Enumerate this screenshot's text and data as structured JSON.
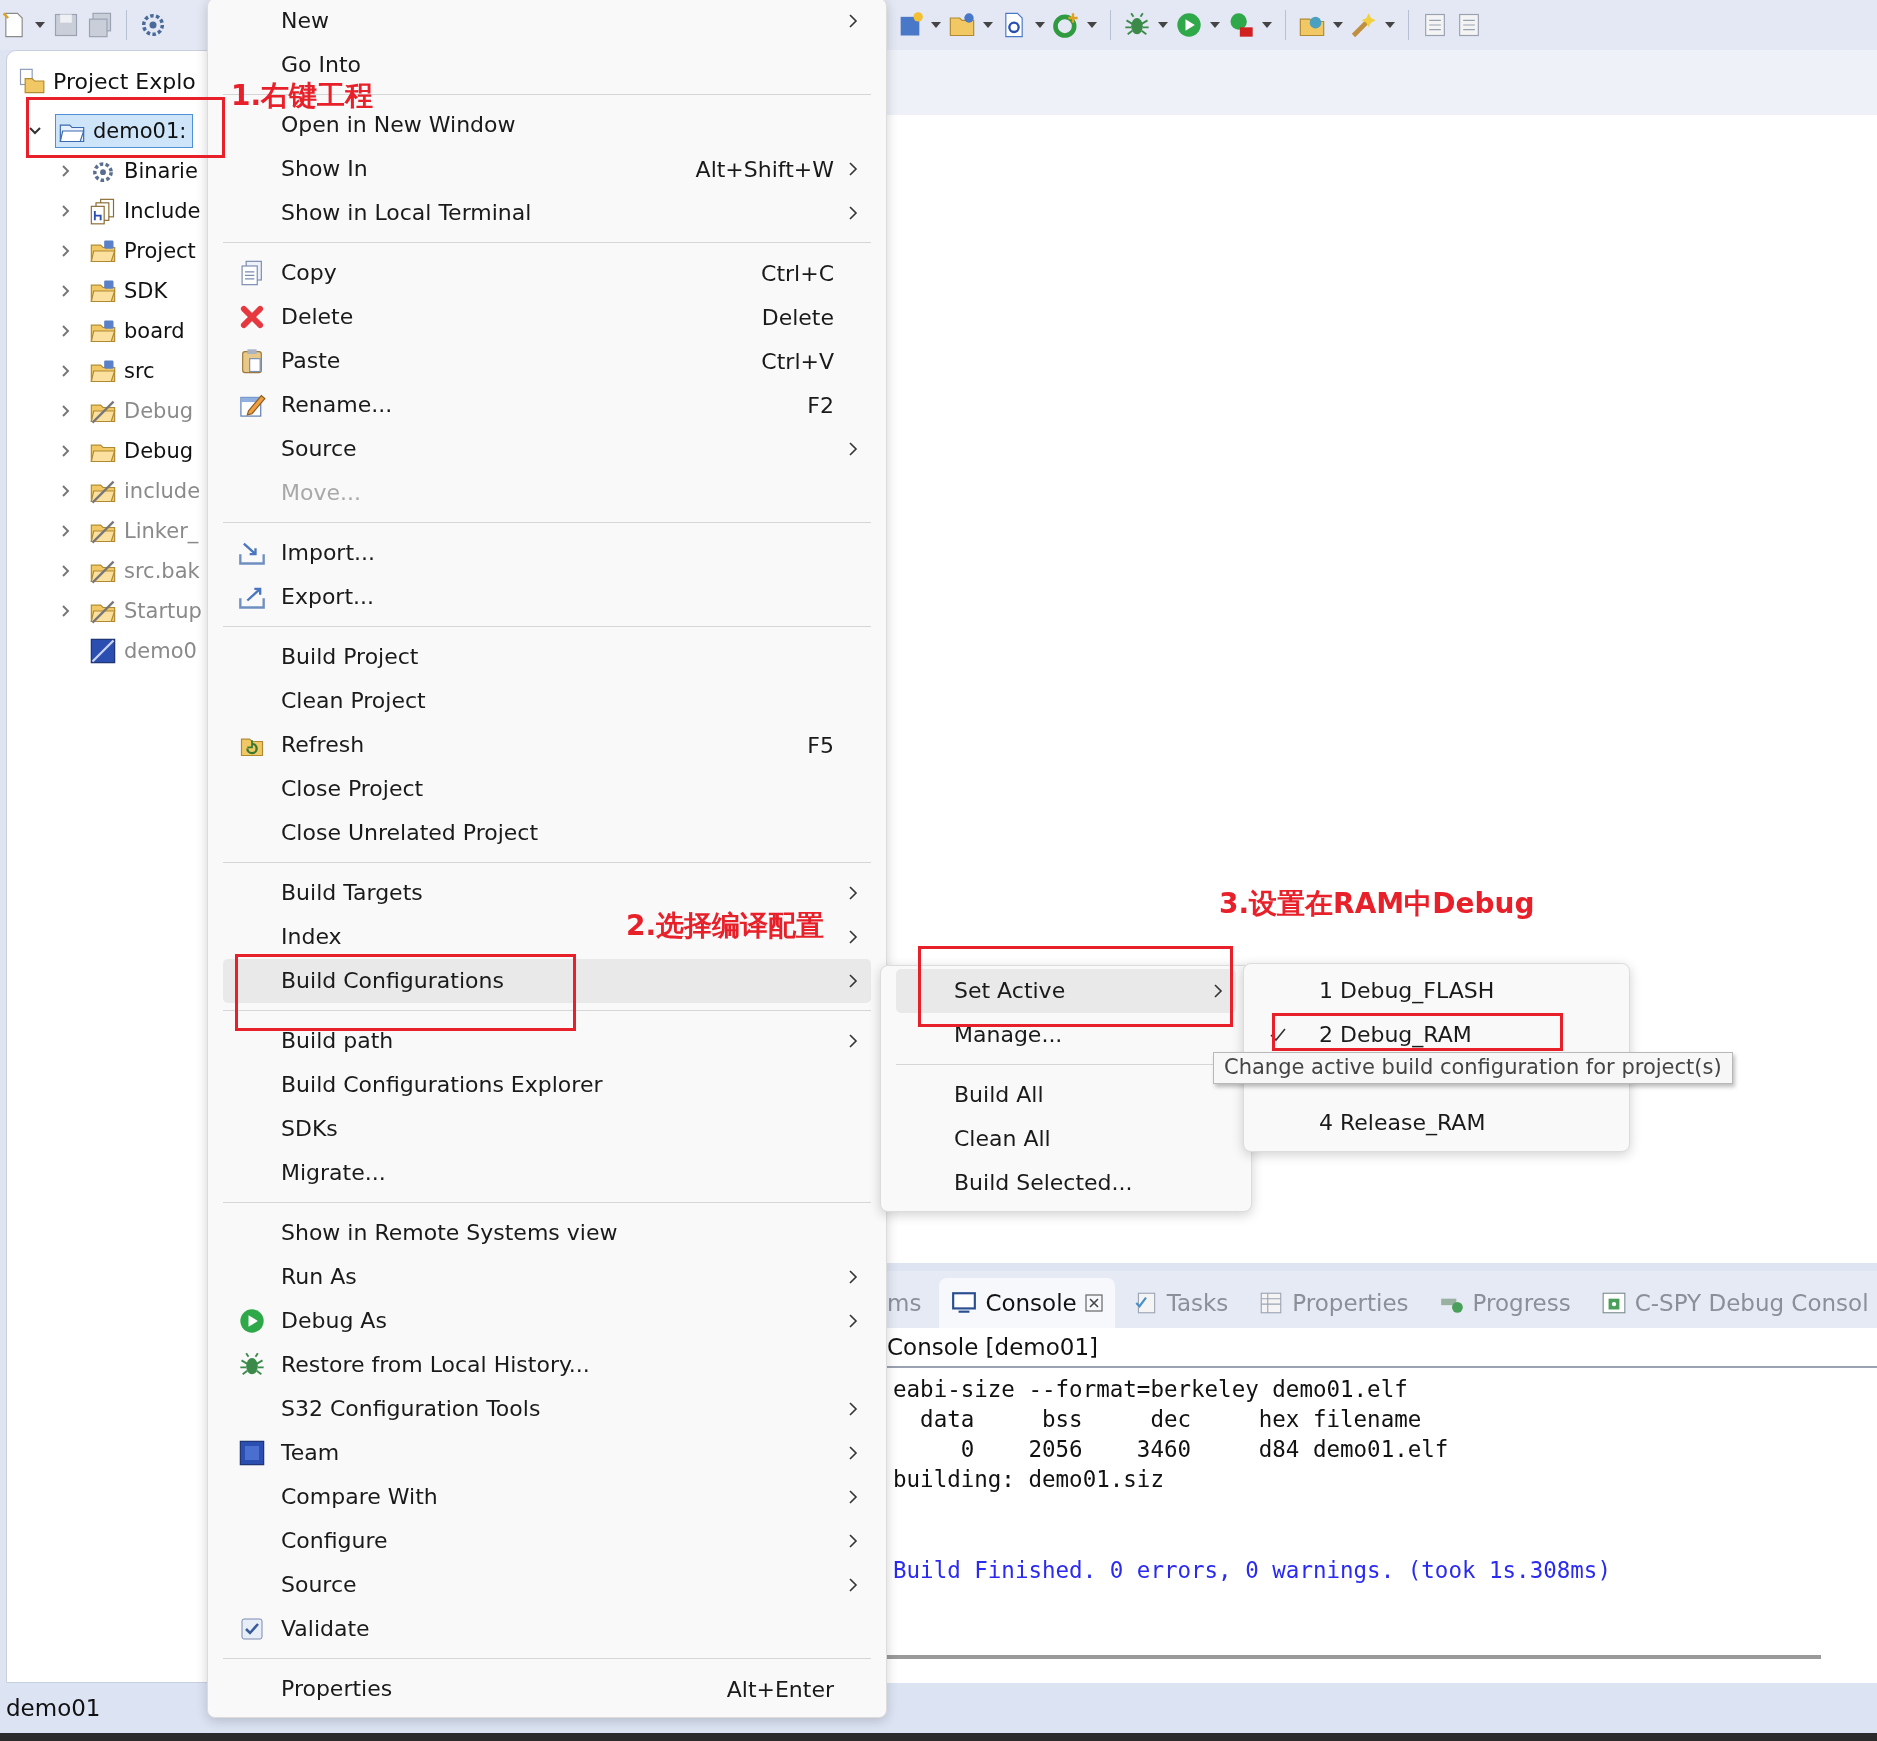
{
  "explorer": {
    "title": "Project Explo",
    "tree": [
      {
        "label": "demo01:",
        "selected": true,
        "expanded": true,
        "excluded": false,
        "children": [
          {
            "label": "Binarie",
            "selected": false,
            "expanded": false,
            "excluded": false
          },
          {
            "label": "Include",
            "selected": false,
            "expanded": false,
            "excluded": false
          },
          {
            "label": "Project",
            "selected": false,
            "expanded": false,
            "excluded": false
          },
          {
            "label": "SDK",
            "selected": false,
            "expanded": false,
            "excluded": false
          },
          {
            "label": "board",
            "selected": false,
            "expanded": false,
            "excluded": false
          },
          {
            "label": "src",
            "selected": false,
            "expanded": false,
            "excluded": false
          },
          {
            "label": "Debug",
            "selected": false,
            "expanded": false,
            "excluded": true
          },
          {
            "label": "Debug",
            "selected": false,
            "expanded": false,
            "excluded": false
          },
          {
            "label": "include",
            "selected": false,
            "expanded": false,
            "excluded": true
          },
          {
            "label": "Linker_",
            "selected": false,
            "expanded": false,
            "excluded": true
          },
          {
            "label": "src.bak",
            "selected": false,
            "expanded": false,
            "excluded": true
          },
          {
            "label": "Startup",
            "selected": false,
            "expanded": false,
            "excluded": true
          },
          {
            "label": "demo0",
            "selected": false,
            "excluded": true
          }
        ]
      }
    ]
  },
  "context_menu": {
    "items": [
      {
        "kind": "item",
        "label": "New",
        "submenu": true,
        "selected": false,
        "disabled": false
      },
      {
        "kind": "item",
        "label": "Go Into",
        "submenu": false,
        "selected": false,
        "disabled": false
      },
      {
        "kind": "separator"
      },
      {
        "kind": "item",
        "label": "Open in New Window",
        "submenu": false,
        "selected": false,
        "disabled": false
      },
      {
        "kind": "item",
        "label": "Show In",
        "shortcut": "Alt+Shift+W",
        "submenu": true,
        "selected": false,
        "disabled": false
      },
      {
        "kind": "item",
        "label": "Show in Local Terminal",
        "submenu": true,
        "selected": false,
        "disabled": false
      },
      {
        "kind": "separator"
      },
      {
        "kind": "item",
        "label": "Copy",
        "shortcut": "Ctrl+C",
        "submenu": false,
        "selected": false,
        "disabled": false
      },
      {
        "kind": "item",
        "label": "Delete",
        "shortcut": "Delete",
        "submenu": false,
        "selected": false,
        "disabled": false
      },
      {
        "kind": "item",
        "label": "Paste",
        "shortcut": "Ctrl+V",
        "submenu": false,
        "selected": false,
        "disabled": false
      },
      {
        "kind": "item",
        "label": "Rename...",
        "shortcut": "F2",
        "submenu": false,
        "selected": false,
        "disabled": false
      },
      {
        "kind": "item",
        "label": "Source",
        "submenu": true,
        "selected": false,
        "disabled": false
      },
      {
        "kind": "item",
        "label": "Move...",
        "submenu": false,
        "selected": false,
        "disabled": true
      },
      {
        "kind": "separator"
      },
      {
        "kind": "item",
        "label": "Import...",
        "submenu": false,
        "selected": false,
        "disabled": false
      },
      {
        "kind": "item",
        "label": "Export...",
        "submenu": false,
        "selected": false,
        "disabled": false
      },
      {
        "kind": "separator"
      },
      {
        "kind": "item",
        "label": "Build Project",
        "submenu": false,
        "selected": false,
        "disabled": false
      },
      {
        "kind": "item",
        "label": "Clean Project",
        "submenu": false,
        "selected": false,
        "disabled": false
      },
      {
        "kind": "item",
        "label": "Refresh",
        "shortcut": "F5",
        "submenu": false,
        "selected": false,
        "disabled": false
      },
      {
        "kind": "item",
        "label": "Close Project",
        "submenu": false,
        "selected": false,
        "disabled": false
      },
      {
        "kind": "item",
        "label": "Close Unrelated Project",
        "submenu": false,
        "selected": false,
        "disabled": false
      },
      {
        "kind": "separator"
      },
      {
        "kind": "item",
        "label": "Build Targets",
        "submenu": true,
        "selected": false,
        "disabled": false
      },
      {
        "kind": "item",
        "label": "Index",
        "submenu": true,
        "selected": false,
        "disabled": false
      },
      {
        "kind": "item",
        "label": "Build Configurations",
        "submenu": true,
        "selected": true,
        "disabled": false
      },
      {
        "kind": "separator"
      },
      {
        "kind": "item",
        "label": "Build path",
        "submenu": true,
        "selected": false,
        "disabled": false
      },
      {
        "kind": "item",
        "label": "Build Configurations Explorer",
        "submenu": false,
        "selected": false,
        "disabled": false
      },
      {
        "kind": "item",
        "label": "SDKs",
        "submenu": false,
        "selected": false,
        "disabled": false
      },
      {
        "kind": "item",
        "label": "Migrate...",
        "submenu": false,
        "selected": false,
        "disabled": false
      },
      {
        "kind": "separator"
      },
      {
        "kind": "item",
        "label": "Show in Remote Systems view",
        "submenu": false,
        "selected": false,
        "disabled": false
      },
      {
        "kind": "item",
        "label": "Run As",
        "submenu": true,
        "selected": false,
        "disabled": false
      },
      {
        "kind": "item",
        "label": "Debug As",
        "submenu": true,
        "selected": false,
        "disabled": false
      },
      {
        "kind": "item",
        "label": "Restore from Local History...",
        "submenu": false,
        "selected": false,
        "disabled": false
      },
      {
        "kind": "item",
        "label": "S32 Configuration Tools",
        "submenu": true,
        "selected": false,
        "disabled": false
      },
      {
        "kind": "item",
        "label": "Team",
        "submenu": true,
        "selected": false,
        "disabled": false
      },
      {
        "kind": "item",
        "label": "Compare With",
        "submenu": true,
        "selected": false,
        "disabled": false
      },
      {
        "kind": "item",
        "label": "Configure",
        "submenu": true,
        "selected": false,
        "disabled": false
      },
      {
        "kind": "item",
        "label": "Source",
        "submenu": true,
        "selected": false,
        "disabled": false
      },
      {
        "kind": "check",
        "label": "Validate",
        "checked": true,
        "submenu": false,
        "selected": false,
        "disabled": false
      },
      {
        "kind": "separator"
      },
      {
        "kind": "item",
        "label": "Properties",
        "shortcut": "Alt+Enter",
        "submenu": false,
        "selected": false,
        "disabled": false
      }
    ]
  },
  "build_configurations_menu": {
    "items": [
      {
        "kind": "item",
        "label": "Set Active",
        "submenu": true,
        "selected": true,
        "disabled": false
      },
      {
        "kind": "item",
        "label": "Manage...",
        "submenu": false,
        "selected": false,
        "disabled": false
      },
      {
        "kind": "separator"
      },
      {
        "kind": "item",
        "label": "Build All",
        "submenu": false,
        "selected": false,
        "disabled": false
      },
      {
        "kind": "item",
        "label": "Clean All",
        "submenu": false,
        "selected": false,
        "disabled": false
      },
      {
        "kind": "item",
        "label": "Build Selected...",
        "submenu": false,
        "selected": false,
        "disabled": false
      }
    ]
  },
  "set_active_menu": {
    "items": [
      {
        "kind": "radio",
        "label": "1 Debug_FLASH",
        "checked": false,
        "submenu": false,
        "selected": false,
        "disabled": false
      },
      {
        "kind": "radio",
        "label": "2 Debug_RAM",
        "checked": true,
        "submenu": false,
        "selected": false,
        "disabled": false
      },
      {
        "kind": "covered"
      },
      {
        "kind": "radio",
        "label": "4 Release_RAM",
        "checked": false,
        "submenu": false,
        "selected": false,
        "disabled": false
      }
    ]
  },
  "tooltip": {
    "text": "Change active build configuration for project(s)"
  },
  "console": {
    "tabs": [
      {
        "label": "ms",
        "selected": false,
        "closable": false
      },
      {
        "label": "Console",
        "selected": true,
        "closable": true
      },
      {
        "label": "Tasks",
        "selected": false,
        "closable": false
      },
      {
        "label": "Properties",
        "selected": false,
        "closable": false
      },
      {
        "label": "Progress",
        "selected": false,
        "closable": false
      },
      {
        "label": "C-SPY Debug Consol",
        "selected": false,
        "closable": false
      }
    ],
    "title": "Console [demo01]",
    "lines": [
      {
        "kind": "output",
        "text": "eabi-size --format=berkeley demo01.elf"
      },
      {
        "kind": "output",
        "text": "  data     bss     dec     hex filename"
      },
      {
        "kind": "output",
        "text": "     0    2056    3460     d84 demo01.elf"
      },
      {
        "kind": "output",
        "text": "building: demo01.siz"
      },
      {
        "kind": "status",
        "text": "Build Finished. 0 errors, 0 warnings. (took 1s.308ms)"
      }
    ]
  },
  "status_bar": {
    "text": "demo01"
  },
  "annotations": {
    "labels": [
      "1.右键工程",
      "2.选择编译配置",
      "3.设置在RAM中Debug"
    ]
  }
}
